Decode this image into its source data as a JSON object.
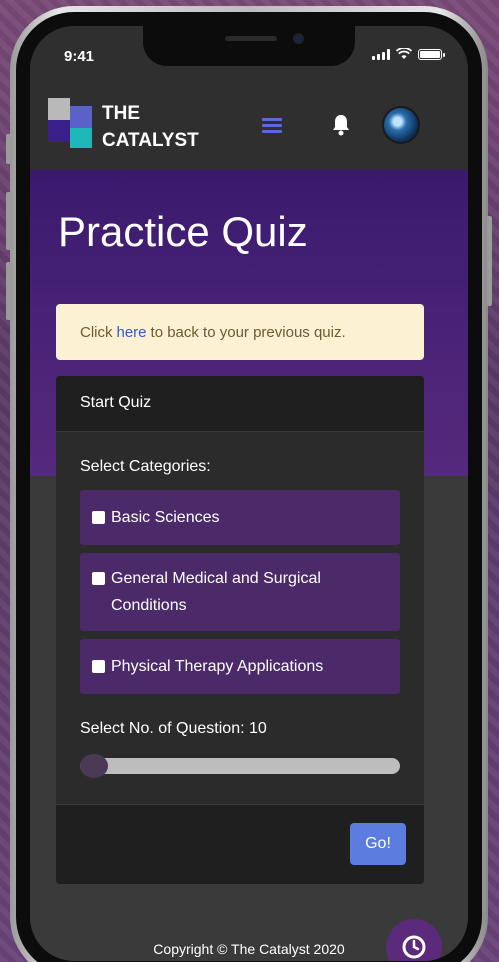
{
  "status_bar": {
    "time": "9:41"
  },
  "navbar": {
    "brand_line1": "THE",
    "brand_line2": "CATALYST",
    "menu_icon": "hamburger-menu-icon",
    "notification_icon": "bell-icon",
    "accent_color": "#5a6ad6"
  },
  "hero": {
    "title": "Practice Quiz",
    "background_color": "#3a1a6e"
  },
  "alert": {
    "text_before": "Click",
    "link_text": "here",
    "text_after": "to back to your previous quiz."
  },
  "quiz_card": {
    "header": "Start Quiz",
    "categories_label": "Select Categories:",
    "categories": [
      {
        "label": "Basic Sciences",
        "checked": false
      },
      {
        "label": "General Medical and Surgical Conditions",
        "checked": false
      },
      {
        "label": "Physical Therapy Applications",
        "checked": false
      }
    ],
    "questions_label": "Select No. of Question: 10",
    "questions_value": 10,
    "go_button": "Go!",
    "go_button_color": "#5c7ce0"
  },
  "footer": {
    "copyright": "Copyright © The Catalyst 2020",
    "fab_icon": "clock-icon"
  }
}
